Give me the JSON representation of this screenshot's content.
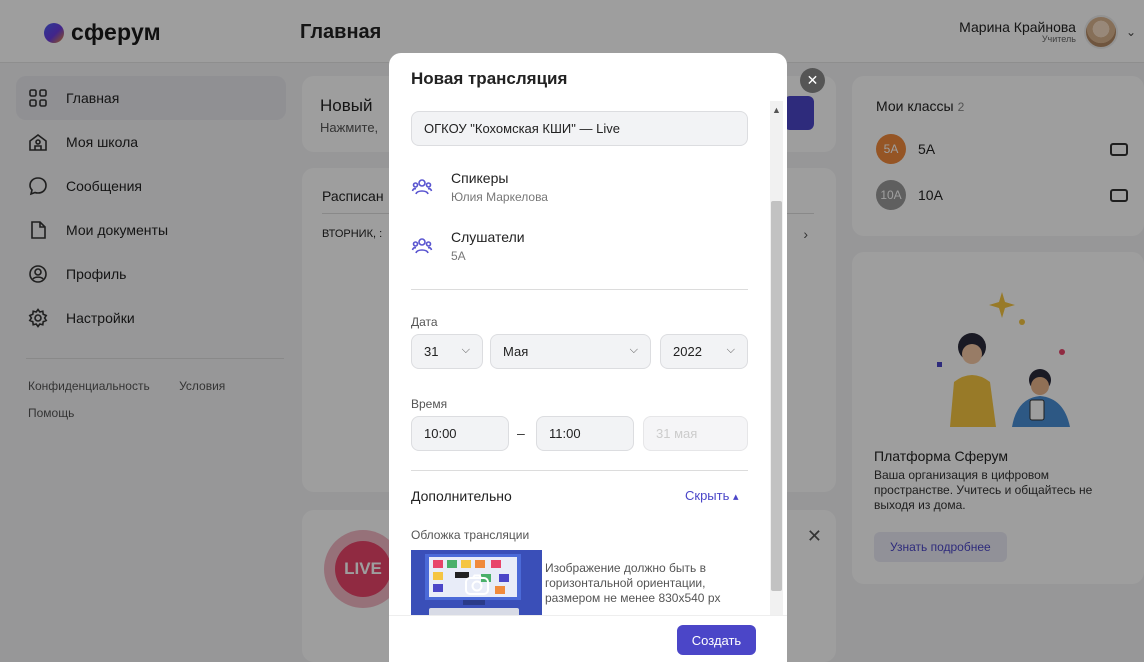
{
  "header": {
    "logo_text": "сферум",
    "page_title": "Главная",
    "user_name": "Марина Крайнова",
    "user_role": "Учитель"
  },
  "sidebar": {
    "items": [
      {
        "label": "Главная",
        "icon": "grid-icon",
        "active": true
      },
      {
        "label": "Моя школа",
        "icon": "school-icon"
      },
      {
        "label": "Сообщения",
        "icon": "chat-icon"
      },
      {
        "label": "Мои документы",
        "icon": "document-icon"
      },
      {
        "label": "Профиль",
        "icon": "profile-icon"
      },
      {
        "label": "Настройки",
        "icon": "gear-icon"
      }
    ],
    "footer": {
      "privacy": "Конфиденциальность",
      "terms": "Условия",
      "help": "Помощь"
    }
  },
  "main": {
    "new_card": {
      "title": "Новый",
      "subtitle": "Нажмите,"
    },
    "schedule_card": {
      "title": "Расписан",
      "day": "ВТОРНИК, :"
    },
    "live_card": {
      "badge": "LIVE"
    }
  },
  "right": {
    "classes": {
      "title": "Мои классы",
      "count": "2",
      "items": [
        {
          "badge": "5А",
          "name": "5А",
          "color": "#f08a3c"
        },
        {
          "badge": "10А",
          "name": "10А",
          "color": "#9a9a9a"
        }
      ]
    },
    "promo": {
      "title": "Платформа Сферум",
      "text": "Ваша организация в цифровом пространстве. Учитесь и общайтесь не выходя из дома.",
      "button": "Узнать подробнее"
    }
  },
  "modal": {
    "title": "Новая трансляция",
    "name_value": "ОГКОУ \"Кохомская КШИ\" — Live",
    "speakers_label": "Спикеры",
    "speakers_value": "Юлия Маркелова",
    "listeners_label": "Слушатели",
    "listeners_value": "5А",
    "date_label": "Дата",
    "day": "31",
    "month": "Мая",
    "year": "2022",
    "time_label": "Время",
    "time_start": "10:00",
    "time_dash": "–",
    "time_end": "11:00",
    "end_date_placeholder": "31 мая",
    "extra_title": "Дополнительно",
    "hide_link": "Скрыть",
    "cover_label": "Обложка трансляции",
    "cover_hint": "Изображение должно быть в горизонтальной ориентации, размером не менее 830x540 px",
    "create_button": "Создать"
  },
  "colors": {
    "accent": "#4b46c8",
    "live": "#e8446a"
  }
}
